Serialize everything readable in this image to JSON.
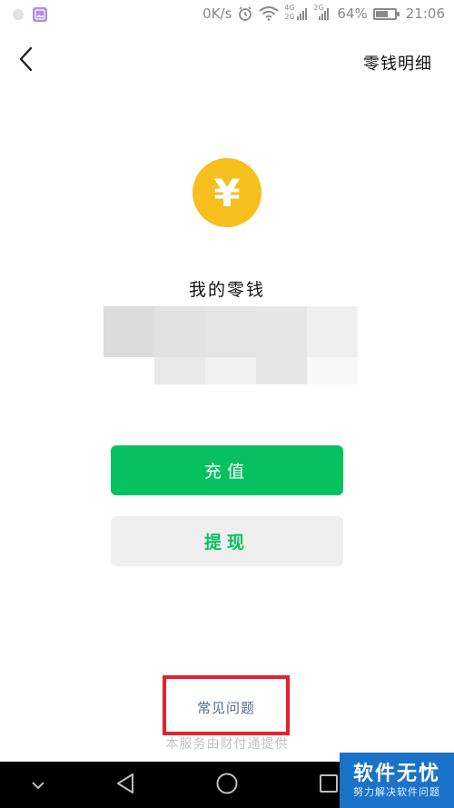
{
  "status_bar": {
    "speed": "0K/s",
    "network_labels": [
      "4G",
      "2G",
      "2G"
    ],
    "battery": "64%",
    "battery_level": 0.64,
    "time": "21:06"
  },
  "header": {
    "back_icon": "chevron-left-icon",
    "detail_link": "零钱明细"
  },
  "wallet": {
    "coin_symbol": "¥",
    "coin_color": "#f7bf1d",
    "title": "我的零钱"
  },
  "actions": {
    "recharge_label": "充值",
    "withdraw_label": "提现",
    "primary_color": "#07c160"
  },
  "footer": {
    "faq_label": "常见问题",
    "provider_note": "本服务由财付通提供",
    "highlight_color": "#e8202d"
  },
  "navbar": {
    "icons": [
      "chevron-down-icon",
      "back-triangle-icon",
      "home-circle-icon",
      "recents-square-icon"
    ]
  },
  "watermark": {
    "main": "软件无忧",
    "sub": "努力解决软件问题"
  }
}
